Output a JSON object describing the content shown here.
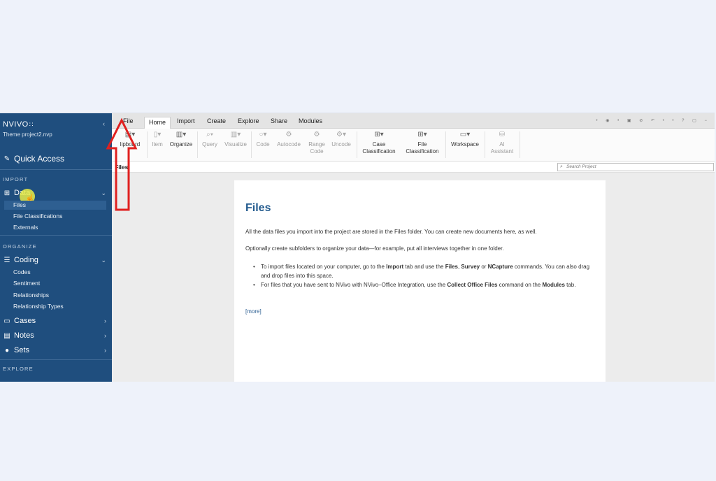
{
  "sidebar": {
    "brand": "NVIVO",
    "brand_mark": "∷",
    "project": "Theme project2.nvp",
    "collapse_icon": "‹",
    "quick_access": "Quick Access",
    "sections": {
      "import": "IMPORT",
      "organize": "ORGANIZE",
      "explore": "EXPLORE"
    },
    "data": {
      "label": "Data",
      "items": [
        "Files",
        "File Classifications",
        "Externals"
      ]
    },
    "coding": {
      "label": "Coding",
      "items": [
        "Codes",
        "Sentiment",
        "Relationships",
        "Relationship Types"
      ]
    },
    "cases": "Cases",
    "notes": "Notes",
    "sets": "Sets"
  },
  "ribbon": {
    "tabs": [
      "File",
      "Home",
      "Import",
      "Create",
      "Explore",
      "Share",
      "Modules"
    ],
    "active_tab": "Home",
    "buttons": {
      "clipboard": "lipboard",
      "item": "Item",
      "organize": "Organize",
      "query": "Query",
      "visualize": "Visualize",
      "code": "Code",
      "autocode": "Autocode",
      "range_code_1": "Range",
      "range_code_2": "Code",
      "uncode": "Uncode",
      "case_class_1": "Case",
      "case_class_2": "Classification",
      "file_class_1": "File",
      "file_class_2": "Classification",
      "workspace": "Workspace",
      "ai_1": "AI",
      "ai_2": "Assistant"
    }
  },
  "pathbar": {
    "label": "Files",
    "search_placeholder": "Search Project"
  },
  "card": {
    "title": "Files",
    "p1": "All the data files you import into the project are stored in the Files folder. You can create new documents here, as well.",
    "p2": "Optionally create subfolders to organize your data—for example, put all interviews together in one folder.",
    "bullet1_a": "To import files located on your computer, go to the ",
    "bullet1_b": "Import",
    "bullet1_c": " tab and use the ",
    "bullet1_d": "Files",
    "bullet1_e": ", ",
    "bullet1_f": "Survey",
    "bullet1_g": " or ",
    "bullet1_h": "NCapture",
    "bullet1_i": " commands. You can also drag and drop files into this space.",
    "bullet2_a": "For files that you have sent to NVivo with NVivo–Office Integration, use the ",
    "bullet2_b": "Collect Office Files",
    "bullet2_c": " command on the ",
    "bullet2_d": "Modules",
    "bullet2_e": " tab.",
    "more": "[more]"
  },
  "colors": {
    "sidebar": "#1f4e7e",
    "accent": "#235b8e",
    "arrow": "#e0201f",
    "highlight": "#e9ec46"
  }
}
